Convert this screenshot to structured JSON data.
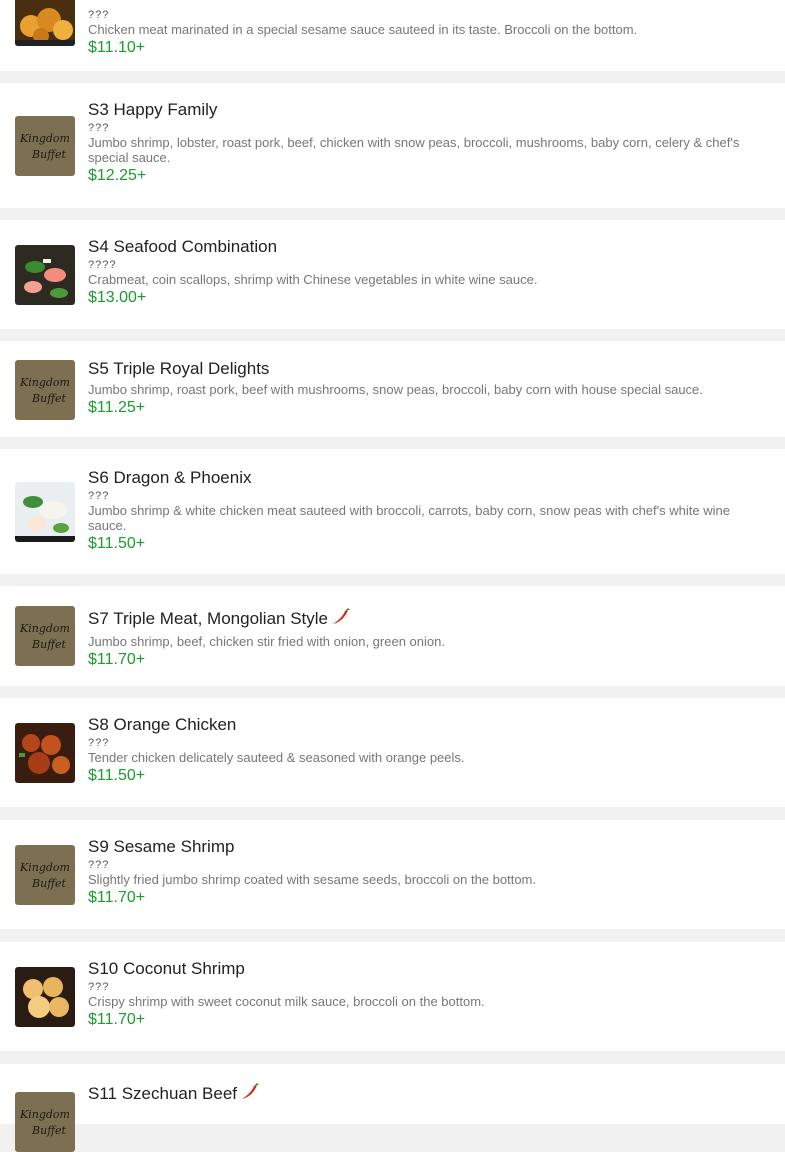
{
  "menu": {
    "items": [
      {
        "id": "s2",
        "name": "",
        "cn": "???",
        "desc": "Chicken meat marinated in a special sesame sauce sauteed in its taste. Broccoli on the bottom.",
        "price": "$11.10+",
        "image": "food-photo-chicken",
        "spicy": false
      },
      {
        "id": "s3",
        "name": "S3 Happy Family",
        "cn": "???",
        "desc": "Jumbo shrimp, lobster, roast pork, beef, chicken with snow peas, broccoli, mushrooms, baby corn, celery & chef's special sauce.",
        "price": "$12.25+",
        "image": "kingdom-buffet-logo",
        "spicy": false
      },
      {
        "id": "s4",
        "name": "S4 Seafood Combination",
        "cn": "????",
        "desc": "Crabmeat, coin scallops, shrimp with Chinese vegetables in white wine sauce.",
        "price": "$13.00+",
        "image": "food-photo-seafood",
        "spicy": false
      },
      {
        "id": "s5",
        "name": "S5 Triple Royal Delights",
        "cn": "",
        "desc": "Jumbo shrimp, roast pork, beef with mushrooms, snow peas, broccoli, baby corn with house special sauce.",
        "price": "$11.25+",
        "image": "kingdom-buffet-logo",
        "spicy": false
      },
      {
        "id": "s6",
        "name": "S6 Dragon & Phoenix",
        "cn": "???",
        "desc": "Jumbo shrimp & white chicken meat sauteed with broccoli, carrots, baby corn, snow peas with chef's white wine sauce.",
        "price": "$11.50+",
        "image": "food-photo-dragon-phoenix",
        "spicy": false
      },
      {
        "id": "s7",
        "name": "S7 Triple Meat, Mongolian Style",
        "cn": "",
        "desc": "Jumbo shrimp, beef, chicken stir fried with onion, green onion.",
        "price": "$11.70+",
        "image": "kingdom-buffet-logo",
        "spicy": true
      },
      {
        "id": "s8",
        "name": "S8 Orange Chicken",
        "cn": "???",
        "desc": "Tender chicken delicately sauteed & seasoned with orange peels.",
        "price": "$11.50+",
        "image": "food-photo-orange-chicken",
        "spicy": false
      },
      {
        "id": "s9",
        "name": "S9 Sesame Shrimp",
        "cn": "???",
        "desc": "Slightly fried jumbo shrimp coated with sesame seeds, broccoli on the bottom.",
        "price": "$11.70+",
        "image": "kingdom-buffet-logo",
        "spicy": false
      },
      {
        "id": "s10",
        "name": "S10 Coconut Shrimp",
        "cn": "???",
        "desc": "Crispy shrimp with sweet coconut milk sauce, broccoli on the bottom.",
        "price": "$11.70+",
        "image": "food-photo-coconut-shrimp",
        "spicy": false
      },
      {
        "id": "s11",
        "name": "S11 Szechuan Beef",
        "cn": "",
        "desc": "",
        "price": "",
        "image": "kingdom-buffet-logo",
        "spicy": true
      }
    ],
    "logo_text_line1": "Kingdom",
    "logo_text_line2": "Buffet",
    "colors": {
      "price": "#1a9e2a",
      "logo_bg": "#7d6f52",
      "logo_text": "#1f1a12",
      "chili": "#d62c1a",
      "separator": "#f1f1f1"
    }
  }
}
